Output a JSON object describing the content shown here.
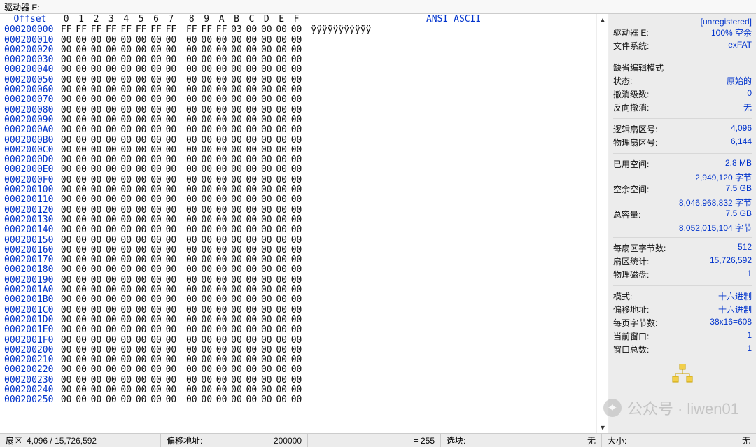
{
  "titlebar": "驱动器 E:",
  "header": {
    "offset_label": "Offset",
    "byte_labels": [
      "0",
      "1",
      "2",
      "3",
      "4",
      "5",
      "6",
      "7",
      "8",
      "9",
      "A",
      "B",
      "C",
      "D",
      "E",
      "F"
    ],
    "ascii_label": "ANSI ASCII"
  },
  "rows": [
    {
      "off": "000200000",
      "b": [
        "FF",
        "FF",
        "FF",
        "FF",
        "FF",
        "FF",
        "FF",
        "FF",
        "FF",
        "FF",
        "FF",
        "03",
        "00",
        "00",
        "00",
        "00"
      ],
      "a": "ÿÿÿÿÿÿÿÿÿÿÿ"
    },
    {
      "off": "000200010",
      "b": [
        "00",
        "00",
        "00",
        "00",
        "00",
        "00",
        "00",
        "00",
        "00",
        "00",
        "00",
        "00",
        "00",
        "00",
        "00",
        "00"
      ],
      "a": ""
    },
    {
      "off": "000200020",
      "b": [
        "00",
        "00",
        "00",
        "00",
        "00",
        "00",
        "00",
        "00",
        "00",
        "00",
        "00",
        "00",
        "00",
        "00",
        "00",
        "00"
      ],
      "a": ""
    },
    {
      "off": "000200030",
      "b": [
        "00",
        "00",
        "00",
        "00",
        "00",
        "00",
        "00",
        "00",
        "00",
        "00",
        "00",
        "00",
        "00",
        "00",
        "00",
        "00"
      ],
      "a": ""
    },
    {
      "off": "000200040",
      "b": [
        "00",
        "00",
        "00",
        "00",
        "00",
        "00",
        "00",
        "00",
        "00",
        "00",
        "00",
        "00",
        "00",
        "00",
        "00",
        "00"
      ],
      "a": ""
    },
    {
      "off": "000200050",
      "b": [
        "00",
        "00",
        "00",
        "00",
        "00",
        "00",
        "00",
        "00",
        "00",
        "00",
        "00",
        "00",
        "00",
        "00",
        "00",
        "00"
      ],
      "a": ""
    },
    {
      "off": "000200060",
      "b": [
        "00",
        "00",
        "00",
        "00",
        "00",
        "00",
        "00",
        "00",
        "00",
        "00",
        "00",
        "00",
        "00",
        "00",
        "00",
        "00"
      ],
      "a": ""
    },
    {
      "off": "000200070",
      "b": [
        "00",
        "00",
        "00",
        "00",
        "00",
        "00",
        "00",
        "00",
        "00",
        "00",
        "00",
        "00",
        "00",
        "00",
        "00",
        "00"
      ],
      "a": ""
    },
    {
      "off": "000200080",
      "b": [
        "00",
        "00",
        "00",
        "00",
        "00",
        "00",
        "00",
        "00",
        "00",
        "00",
        "00",
        "00",
        "00",
        "00",
        "00",
        "00"
      ],
      "a": ""
    },
    {
      "off": "000200090",
      "b": [
        "00",
        "00",
        "00",
        "00",
        "00",
        "00",
        "00",
        "00",
        "00",
        "00",
        "00",
        "00",
        "00",
        "00",
        "00",
        "00"
      ],
      "a": ""
    },
    {
      "off": "0002000A0",
      "b": [
        "00",
        "00",
        "00",
        "00",
        "00",
        "00",
        "00",
        "00",
        "00",
        "00",
        "00",
        "00",
        "00",
        "00",
        "00",
        "00"
      ],
      "a": ""
    },
    {
      "off": "0002000B0",
      "b": [
        "00",
        "00",
        "00",
        "00",
        "00",
        "00",
        "00",
        "00",
        "00",
        "00",
        "00",
        "00",
        "00",
        "00",
        "00",
        "00"
      ],
      "a": ""
    },
    {
      "off": "0002000C0",
      "b": [
        "00",
        "00",
        "00",
        "00",
        "00",
        "00",
        "00",
        "00",
        "00",
        "00",
        "00",
        "00",
        "00",
        "00",
        "00",
        "00"
      ],
      "a": ""
    },
    {
      "off": "0002000D0",
      "b": [
        "00",
        "00",
        "00",
        "00",
        "00",
        "00",
        "00",
        "00",
        "00",
        "00",
        "00",
        "00",
        "00",
        "00",
        "00",
        "00"
      ],
      "a": ""
    },
    {
      "off": "0002000E0",
      "b": [
        "00",
        "00",
        "00",
        "00",
        "00",
        "00",
        "00",
        "00",
        "00",
        "00",
        "00",
        "00",
        "00",
        "00",
        "00",
        "00"
      ],
      "a": ""
    },
    {
      "off": "0002000F0",
      "b": [
        "00",
        "00",
        "00",
        "00",
        "00",
        "00",
        "00",
        "00",
        "00",
        "00",
        "00",
        "00",
        "00",
        "00",
        "00",
        "00"
      ],
      "a": ""
    },
    {
      "off": "000200100",
      "b": [
        "00",
        "00",
        "00",
        "00",
        "00",
        "00",
        "00",
        "00",
        "00",
        "00",
        "00",
        "00",
        "00",
        "00",
        "00",
        "00"
      ],
      "a": ""
    },
    {
      "off": "000200110",
      "b": [
        "00",
        "00",
        "00",
        "00",
        "00",
        "00",
        "00",
        "00",
        "00",
        "00",
        "00",
        "00",
        "00",
        "00",
        "00",
        "00"
      ],
      "a": ""
    },
    {
      "off": "000200120",
      "b": [
        "00",
        "00",
        "00",
        "00",
        "00",
        "00",
        "00",
        "00",
        "00",
        "00",
        "00",
        "00",
        "00",
        "00",
        "00",
        "00"
      ],
      "a": ""
    },
    {
      "off": "000200130",
      "b": [
        "00",
        "00",
        "00",
        "00",
        "00",
        "00",
        "00",
        "00",
        "00",
        "00",
        "00",
        "00",
        "00",
        "00",
        "00",
        "00"
      ],
      "a": ""
    },
    {
      "off": "000200140",
      "b": [
        "00",
        "00",
        "00",
        "00",
        "00",
        "00",
        "00",
        "00",
        "00",
        "00",
        "00",
        "00",
        "00",
        "00",
        "00",
        "00"
      ],
      "a": ""
    },
    {
      "off": "000200150",
      "b": [
        "00",
        "00",
        "00",
        "00",
        "00",
        "00",
        "00",
        "00",
        "00",
        "00",
        "00",
        "00",
        "00",
        "00",
        "00",
        "00"
      ],
      "a": ""
    },
    {
      "off": "000200160",
      "b": [
        "00",
        "00",
        "00",
        "00",
        "00",
        "00",
        "00",
        "00",
        "00",
        "00",
        "00",
        "00",
        "00",
        "00",
        "00",
        "00"
      ],
      "a": ""
    },
    {
      "off": "000200170",
      "b": [
        "00",
        "00",
        "00",
        "00",
        "00",
        "00",
        "00",
        "00",
        "00",
        "00",
        "00",
        "00",
        "00",
        "00",
        "00",
        "00"
      ],
      "a": ""
    },
    {
      "off": "000200180",
      "b": [
        "00",
        "00",
        "00",
        "00",
        "00",
        "00",
        "00",
        "00",
        "00",
        "00",
        "00",
        "00",
        "00",
        "00",
        "00",
        "00"
      ],
      "a": ""
    },
    {
      "off": "000200190",
      "b": [
        "00",
        "00",
        "00",
        "00",
        "00",
        "00",
        "00",
        "00",
        "00",
        "00",
        "00",
        "00",
        "00",
        "00",
        "00",
        "00"
      ],
      "a": ""
    },
    {
      "off": "0002001A0",
      "b": [
        "00",
        "00",
        "00",
        "00",
        "00",
        "00",
        "00",
        "00",
        "00",
        "00",
        "00",
        "00",
        "00",
        "00",
        "00",
        "00"
      ],
      "a": ""
    },
    {
      "off": "0002001B0",
      "b": [
        "00",
        "00",
        "00",
        "00",
        "00",
        "00",
        "00",
        "00",
        "00",
        "00",
        "00",
        "00",
        "00",
        "00",
        "00",
        "00"
      ],
      "a": ""
    },
    {
      "off": "0002001C0",
      "b": [
        "00",
        "00",
        "00",
        "00",
        "00",
        "00",
        "00",
        "00",
        "00",
        "00",
        "00",
        "00",
        "00",
        "00",
        "00",
        "00"
      ],
      "a": ""
    },
    {
      "off": "0002001D0",
      "b": [
        "00",
        "00",
        "00",
        "00",
        "00",
        "00",
        "00",
        "00",
        "00",
        "00",
        "00",
        "00",
        "00",
        "00",
        "00",
        "00"
      ],
      "a": ""
    },
    {
      "off": "0002001E0",
      "b": [
        "00",
        "00",
        "00",
        "00",
        "00",
        "00",
        "00",
        "00",
        "00",
        "00",
        "00",
        "00",
        "00",
        "00",
        "00",
        "00"
      ],
      "a": ""
    },
    {
      "off": "0002001F0",
      "b": [
        "00",
        "00",
        "00",
        "00",
        "00",
        "00",
        "00",
        "00",
        "00",
        "00",
        "00",
        "00",
        "00",
        "00",
        "00",
        "00"
      ],
      "a": ""
    },
    {
      "off": "000200200",
      "b": [
        "00",
        "00",
        "00",
        "00",
        "00",
        "00",
        "00",
        "00",
        "00",
        "00",
        "00",
        "00",
        "00",
        "00",
        "00",
        "00"
      ],
      "a": ""
    },
    {
      "off": "000200210",
      "b": [
        "00",
        "00",
        "00",
        "00",
        "00",
        "00",
        "00",
        "00",
        "00",
        "00",
        "00",
        "00",
        "00",
        "00",
        "00",
        "00"
      ],
      "a": ""
    },
    {
      "off": "000200220",
      "b": [
        "00",
        "00",
        "00",
        "00",
        "00",
        "00",
        "00",
        "00",
        "00",
        "00",
        "00",
        "00",
        "00",
        "00",
        "00",
        "00"
      ],
      "a": ""
    },
    {
      "off": "000200230",
      "b": [
        "00",
        "00",
        "00",
        "00",
        "00",
        "00",
        "00",
        "00",
        "00",
        "00",
        "00",
        "00",
        "00",
        "00",
        "00",
        "00"
      ],
      "a": ""
    },
    {
      "off": "000200240",
      "b": [
        "00",
        "00",
        "00",
        "00",
        "00",
        "00",
        "00",
        "00",
        "00",
        "00",
        "00",
        "00",
        "00",
        "00",
        "00",
        "00"
      ],
      "a": ""
    },
    {
      "off": "000200250",
      "b": [
        "00",
        "00",
        "00",
        "00",
        "00",
        "00",
        "00",
        "00",
        "00",
        "00",
        "00",
        "00",
        "00",
        "00",
        "00",
        "00"
      ],
      "a": ""
    }
  ],
  "info": {
    "unregistered": "[unregistered]",
    "drive_label": "驱动器 E:",
    "drive_value": "100% 空余",
    "fs_label": "文件系统:",
    "fs_value": "exFAT",
    "edit_mode_label": "缺省编辑模式",
    "state_label": "状态:",
    "state_value": "原始的",
    "undo_levels_label": "撤消级数:",
    "undo_levels_value": "0",
    "reverse_undo_label": "反向撤消:",
    "reverse_undo_value": "无",
    "logical_sector_label": "逻辑扇区号:",
    "logical_sector_value": "4,096",
    "physical_sector_label": "物理扇区号:",
    "physical_sector_value": "6,144",
    "used_label": "已用空间:",
    "used_value": "2.8 MB",
    "used_bytes": "2,949,120 字节",
    "free_label": "空余空间:",
    "free_value": "7.5 GB",
    "free_bytes": "8,046,968,832 字节",
    "total_label": "总容量:",
    "total_value": "7.5 GB",
    "total_bytes": "8,052,015,104 字节",
    "bps_label": "每扇区字节数:",
    "bps_value": "512",
    "sector_stat_label": "扇区统计:",
    "sector_stat_value": "15,726,592",
    "phys_disk_label": "物理磁盘:",
    "phys_disk_value": "1",
    "mode_label": "模式:",
    "mode_value": "十六进制",
    "offset_addr_label": "偏移地址:",
    "offset_addr_value": "十六进制",
    "page_bytes_label": "每页字节数:",
    "page_bytes_value": "38x16=608",
    "curwin_label": "当前窗口:",
    "curwin_value": "1",
    "totalwin_label": "窗口总数:",
    "totalwin_value": "1"
  },
  "status": {
    "sector_label": "扇区",
    "sector_value": "4,096 / 15,726,592",
    "offset_label": "偏移地址:",
    "offset_value": "200000",
    "eq_value": "= 255",
    "sel_label": "选块:",
    "sel_value": "无",
    "size_label": "大小:",
    "size_value": "无"
  },
  "watermark": {
    "label": "公众号 · liwen01"
  }
}
